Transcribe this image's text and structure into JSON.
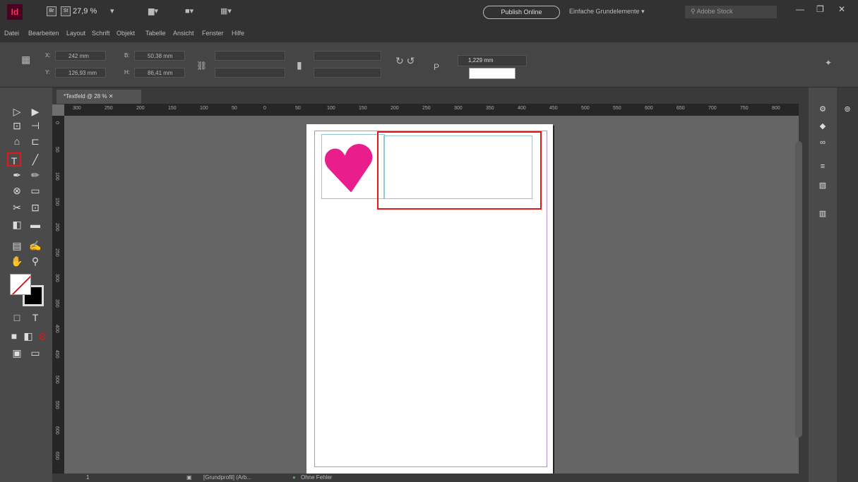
{
  "titlebar": {
    "logo": "Id",
    "zoom": "27,9 %",
    "publish": "Publish Online",
    "workspace": "Einfache Grundelemente",
    "search_placeholder": "Adobe Stock"
  },
  "menu": [
    "Datei",
    "Bearbeiten",
    "Layout",
    "Schrift",
    "Objekt",
    "Tabelle",
    "Ansicht",
    "Fenster",
    "Hilfe"
  ],
  "control": {
    "x": "X:",
    "x_val": "242 mm",
    "y": "Y:",
    "y_val": "126,93 mm",
    "w": "B:",
    "w_val": "50,38 mm",
    "h": "H:",
    "h_val": "86,41 mm",
    "stroke": "1,229 mm",
    "p": "P"
  },
  "doc_tab": "*Textfeld @ 28 %",
  "ruler_top": [
    "300",
    "250",
    "200",
    "150",
    "100",
    "50",
    "0",
    "50",
    "100",
    "150",
    "200",
    "250",
    "300",
    "350",
    "400",
    "450",
    "500",
    "550",
    "600",
    "650",
    "700",
    "750",
    "800"
  ],
  "ruler_left": [
    "0",
    "50",
    "100",
    "150",
    "200",
    "250",
    "300",
    "350",
    "400",
    "450",
    "500",
    "550",
    "600",
    "650"
  ],
  "status": {
    "page": "1",
    "style": "[Grundprofil] (Arb...",
    "errors": "Ohne Fehler"
  },
  "colors": {
    "accent": "#e21818",
    "heart": "#e91e8c"
  }
}
